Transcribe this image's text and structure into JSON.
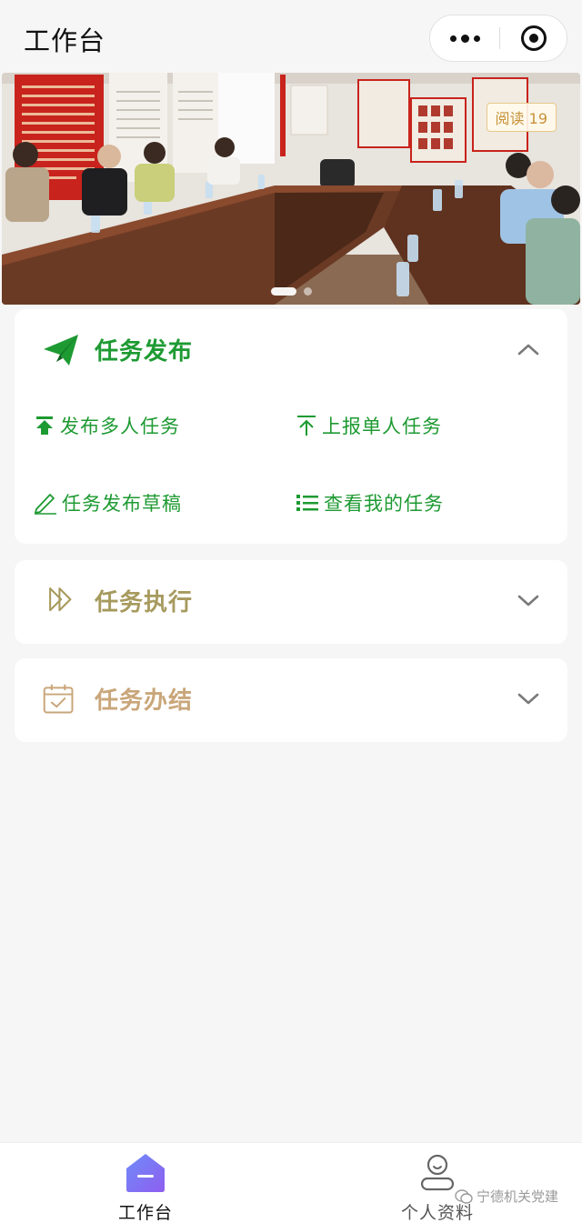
{
  "header": {
    "title": "工作台",
    "more_icon": "more-dots-icon",
    "close_icon": "close-miniprogram-icon"
  },
  "banner": {
    "read_label": "阅读 19",
    "slide_count": 2,
    "active_slide": 1
  },
  "sections": {
    "publish": {
      "title": "任务发布",
      "icon": "paper-plane-icon",
      "expanded": true,
      "color": "#1e9a32",
      "actions": [
        {
          "label": "发布多人任务",
          "icon": "upload-arrow-icon"
        },
        {
          "label": "上报单人任务",
          "icon": "up-arrow-icon"
        },
        {
          "label": "任务发布草稿",
          "icon": "pencil-icon"
        },
        {
          "label": "查看我的任务",
          "icon": "list-icon"
        }
      ]
    },
    "execute": {
      "title": "任务执行",
      "icon": "fast-forward-icon",
      "expanded": false,
      "color": "#a79a5e"
    },
    "complete": {
      "title": "任务办结",
      "icon": "calendar-check-icon",
      "expanded": false,
      "color": "#c9a67a"
    }
  },
  "tabbar": {
    "items": [
      {
        "label": "工作台",
        "icon": "home-icon",
        "active": true
      },
      {
        "label": "个人资料",
        "icon": "user-icon",
        "active": false
      }
    ]
  },
  "watermark": {
    "text": "宁德机关党建"
  },
  "colors": {
    "primary_green": "#1e9a32",
    "execute_olive": "#a79a5e",
    "complete_tan": "#c9a67a",
    "tab_active_gradient_start": "#6f8cf8",
    "tab_active_gradient_end": "#8e5ef0"
  }
}
